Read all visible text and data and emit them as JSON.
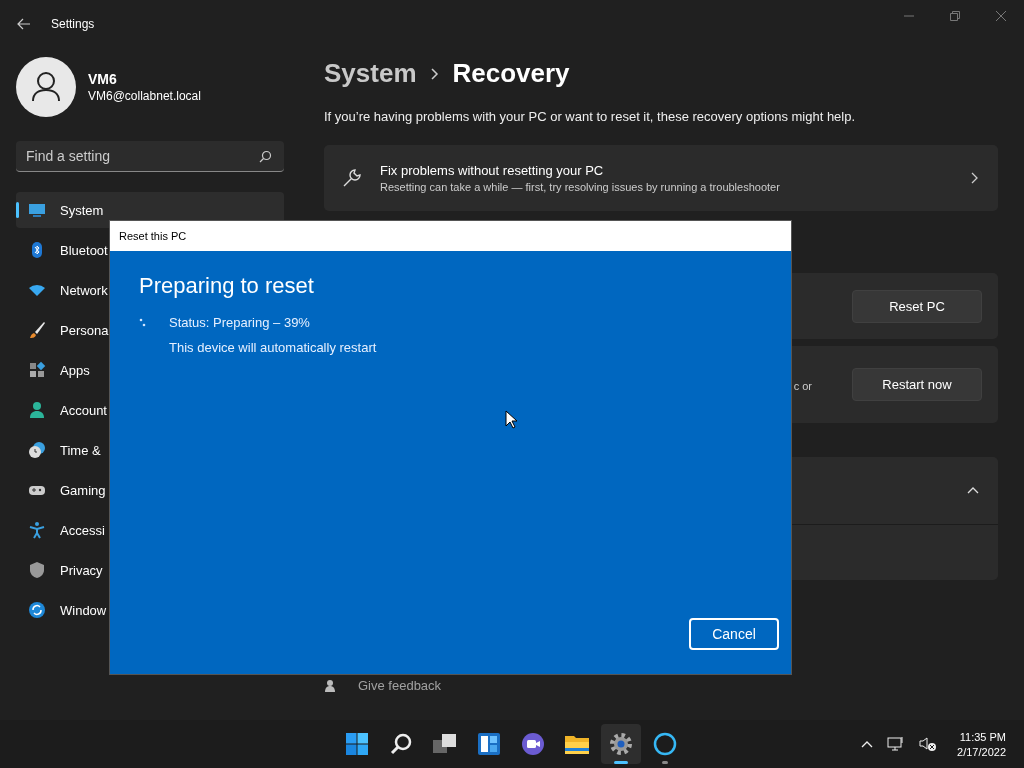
{
  "window": {
    "title": "Settings"
  },
  "user": {
    "name": "VM6",
    "email": "VM6@collabnet.local"
  },
  "search": {
    "placeholder": "Find a setting"
  },
  "nav": [
    {
      "label": "System",
      "selected": true
    },
    {
      "label": "Bluetoot",
      "selected": false
    },
    {
      "label": "Network",
      "selected": false
    },
    {
      "label": "Persona",
      "selected": false
    },
    {
      "label": "Apps",
      "selected": false
    },
    {
      "label": "Account",
      "selected": false
    },
    {
      "label": "Time &",
      "selected": false
    },
    {
      "label": "Gaming",
      "selected": false
    },
    {
      "label": "Accessi",
      "selected": false
    },
    {
      "label": "Privacy",
      "selected": false
    },
    {
      "label": "Window",
      "selected": false
    }
  ],
  "breadcrumb": {
    "parent": "System",
    "current": "Recovery"
  },
  "description": "If you’re having problems with your PC or want to reset it, these recovery options might help.",
  "cards": [
    {
      "kind": "link",
      "title": "Fix problems without resetting your PC",
      "subtitle": "Resetting can take a while — first, try resolving issues by running a troubleshooter"
    },
    {
      "kind": "action",
      "button": "Reset PC"
    },
    {
      "kind": "action",
      "text": "c or",
      "button": "Restart now"
    },
    {
      "kind": "expander",
      "expanded": true
    }
  ],
  "give_feedback": "Give feedback",
  "dialog": {
    "title": "Reset this PC",
    "heading": "Preparing to reset",
    "status": "Status: Preparing – 39%",
    "note": "This device will automatically restart",
    "cancel": "Cancel"
  },
  "taskbar": [
    {
      "kind": "start",
      "active": false
    },
    {
      "kind": "search",
      "active": false
    },
    {
      "kind": "taskview",
      "active": false
    },
    {
      "kind": "widgets",
      "active": false
    },
    {
      "kind": "chat",
      "active": false
    },
    {
      "kind": "explorer",
      "active": false
    },
    {
      "kind": "settings",
      "active": true
    },
    {
      "kind": "cortana",
      "active": false
    }
  ],
  "tray": {
    "time": "11:35 PM",
    "date": "2/17/2022"
  }
}
